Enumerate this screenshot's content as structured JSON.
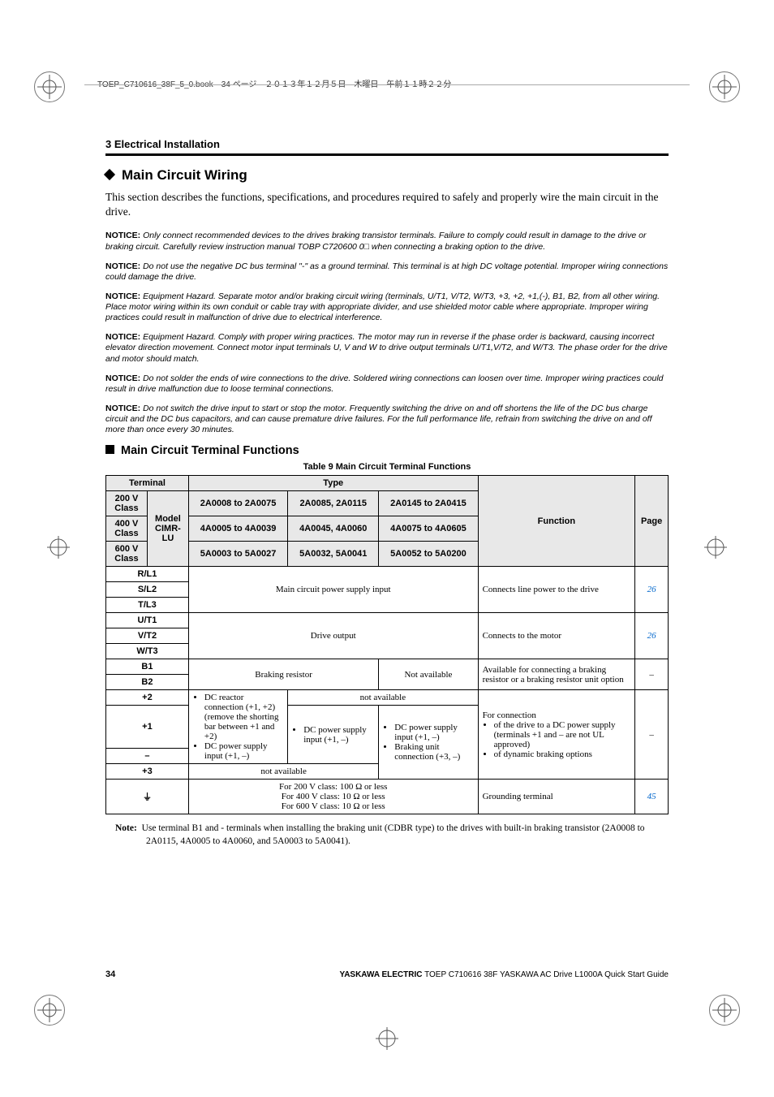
{
  "print_header": "TOEP_C710616_38F_5_0.book　34 ページ　２０１３年１２月５日　木曜日　午前１１時２２分",
  "breadcrumb": "3  Electrical Installation",
  "h2": "Main Circuit Wiring",
  "intro": "This section describes the functions, specifications, and procedures required to safely and properly wire the main circuit in the drive.",
  "notices": [
    "Only connect recommended devices to the drives braking transistor terminals. Failure to comply could result in damage to the drive or braking circuit. Carefully review instruction manual TOBP C720600 0□ when connecting a braking option to the drive.",
    "Do not use the negative DC bus terminal \"-\" as a ground terminal. This terminal is at high DC voltage potential. Improper wiring connections could damage the drive.",
    "Equipment Hazard. Separate motor and/or braking circuit wiring (terminals, U/T1, V/T2, W/T3, +3, +2, +1,(-), B1, B2, from all other wiring. Place motor wiring within its own conduit or cable tray with appropriate divider, and use shielded motor cable where appropriate. Improper wiring practices could result in malfunction of drive due to electrical interference.",
    "Equipment Hazard. Comply with proper wiring practices. The motor may run in reverse if the phase order is backward, causing incorrect elevator direction movement. Connect motor input terminals U, V and W to drive output terminals U/T1,V/T2, and W/T3. The phase order for the drive and motor should match.",
    "Do not solder the ends of wire connections to the drive. Soldered wiring connections can loosen over time. Improper wiring practices could result in drive malfunction due to loose terminal connections.",
    "Do not switch the drive input to start or stop the motor. Frequently switching the drive on and off shortens the life of the DC bus charge circuit and the DC bus capacitors, and can cause premature drive failures. For the full performance life, refrain from switching the drive on and off more than once every 30 minutes."
  ],
  "h3": "Main Circuit Terminal Functions",
  "table_caption": "Table 9  Main Circuit Terminal Functions",
  "table": {
    "headers": {
      "terminal": "Terminal",
      "type": "Type",
      "v200": "200 V Class",
      "v400": "400 V Class",
      "v600": "600 V Class",
      "model": "Model CIMR-LU",
      "r200c1": "2A0008 to 2A0075",
      "r200c2": "2A0085, 2A0115",
      "r200c3": "2A0145 to 2A0415",
      "r400c1": "4A0005 to 4A0039",
      "r400c2": "4A0045, 4A0060",
      "r400c3": "4A0075 to 4A0605",
      "r600c1": "5A0003 to 5A0027",
      "r600c2": "5A0032, 5A0041",
      "r600c3": "5A0052 to 5A0200",
      "function": "Function",
      "page": "Page"
    },
    "row_main_power": {
      "t1": "R/L1",
      "t2": "S/L2",
      "t3": "T/L3",
      "type": "Main circuit power supply input",
      "func": "Connects line power to the drive",
      "page": "26"
    },
    "row_drive_output": {
      "t1": "U/T1",
      "t2": "V/T2",
      "t3": "W/T3",
      "type": "Drive output",
      "func": "Connects to the motor",
      "page": "26"
    },
    "row_braking": {
      "t1": "B1",
      "t2": "B2",
      "type": "Braking resistor",
      "type_c3": "Not available",
      "func": "Available for connecting a braking resistor or a braking resistor unit option",
      "page": "–"
    },
    "row_dc": {
      "t_plus2": "+2",
      "t_plus1": "+1",
      "t_minus": "–",
      "t_plus3": "+3",
      "plus2_col1": "DC reactor connection (+1, +2) (remove the shorting bar between +1 and +2)",
      "plus2_col23": "not available",
      "minus_col1_b": "DC power supply input (+1, –)",
      "col2_item": "DC power supply input (+1, –)",
      "col3_item1": "DC power supply input (+1, –)",
      "col3_item2": "Braking unit connection (+3, –)",
      "plus3_col12": "not available",
      "func_intro": "For connection",
      "func_b1": "of the drive to a DC power supply (terminals +1 and – are not UL approved)",
      "func_b2": "of dynamic braking options",
      "page": "–"
    },
    "row_ground": {
      "t": "⏚",
      "type_l1": "For 200 V class: 100 Ω or less",
      "type_l2": "For 400 V class: 10 Ω or less",
      "type_l3": "For 600 V class: 10 Ω or less",
      "func": "Grounding terminal",
      "page": "45"
    }
  },
  "note": {
    "label": "Note:",
    "text": "Use terminal B1 and - terminals when installing the braking unit (CDBR type) to the drives with built-in braking transistor (2A0008 to 2A0115, 4A0005 to 4A0060, and 5A0003 to 5A0041)."
  },
  "footer": {
    "pagenum": "34",
    "text_bold": "YASKAWA ELECTRIC",
    "text_rest": " TOEP C710616 38F YASKAWA AC Drive L1000A Quick Start Guide"
  }
}
